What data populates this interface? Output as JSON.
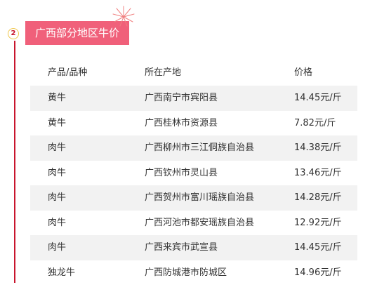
{
  "section": {
    "number": "2",
    "title": "广西部分地区牛价"
  },
  "table": {
    "headers": [
      "产品/品种",
      "所在产地",
      "价格"
    ],
    "rows": [
      [
        "黄牛",
        "广西南宁市宾阳县",
        "14.45元/斤"
      ],
      [
        "黄牛",
        "广西桂林市资源县",
        "7.82元/斤"
      ],
      [
        "肉牛",
        "广西柳州市三江侗族自治县",
        "14.38元/斤"
      ],
      [
        "肉牛",
        "广西钦州市灵山县",
        "13.46元/斤"
      ],
      [
        "肉牛",
        "广西贺州市富川瑶族自治县",
        "14.28元/斤"
      ],
      [
        "肉牛",
        "广西河池市都安瑶族自治县",
        "12.92元/斤"
      ],
      [
        "肉牛",
        "广西来宾市武宣县",
        "14.45元/斤"
      ],
      [
        "独龙牛",
        "广西防城港市防城区",
        "14.96元/斤"
      ]
    ]
  },
  "colors": {
    "title_bg": "#f0607a",
    "accent_line": "#c8152d",
    "row_shade": "#f2f2f2",
    "circle_border": "#f0c64a"
  },
  "icons": {
    "firework": "firework-icon"
  }
}
